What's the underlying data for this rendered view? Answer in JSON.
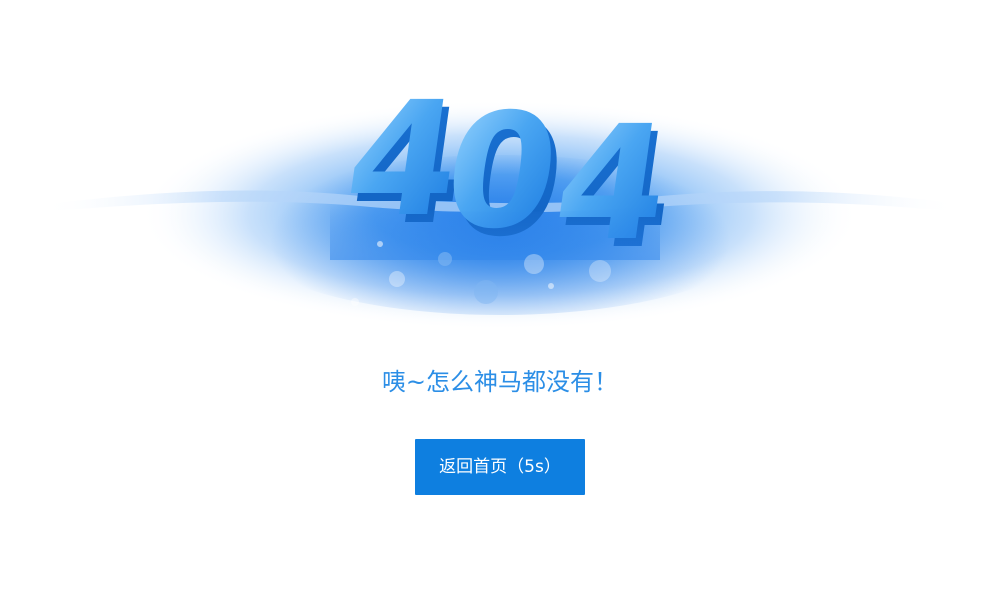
{
  "error_page": {
    "code": "404",
    "message": "咦~怎么神马都没有！",
    "home_button_label": "返回首页（5s）"
  },
  "colors": {
    "accent": "#1a8be7",
    "button": "#0e7fe0",
    "message": "#2b8ee6",
    "water_deep": "#2d86ee",
    "water_light": "#c9e1fb",
    "digit_light": "#8fd0ff",
    "digit_dark": "#1576df"
  },
  "icons": {
    "illustration": "404-water-illustration"
  }
}
